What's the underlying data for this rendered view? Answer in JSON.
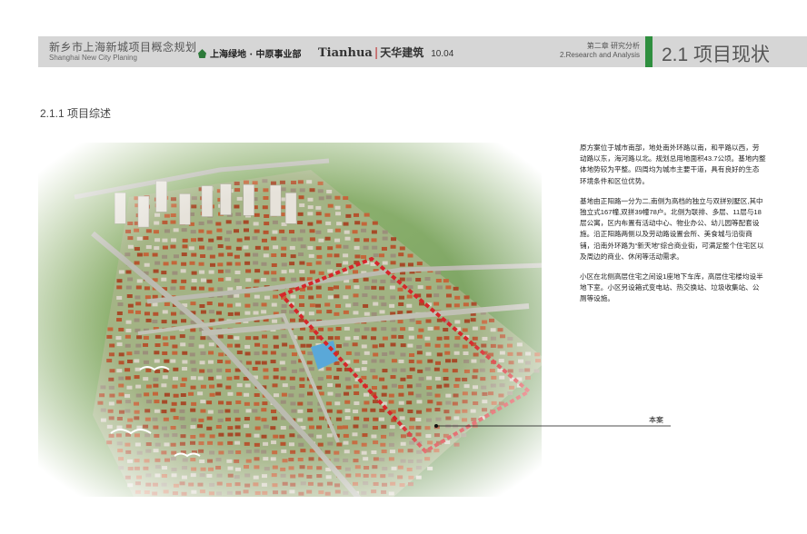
{
  "header": {
    "project_title": "新乡市上海新城项目概念规划",
    "project_title_en": "Shanghai New City Planing",
    "logo_greenland": "上海绿地 · 中原事业部",
    "logo_tianhua_en": "Tianhua",
    "logo_tianhua_cn": "天华建筑",
    "date": "10.04",
    "chapter_cn": "第二章  研究分析",
    "chapter_en": "2.Research and Analysis",
    "section_title": "2.1 项目现状"
  },
  "subsection": "2.1.1 项目综述",
  "description": [
    "原方案位于城市南部，地处南外环路以南，和平路以西，劳动路以东，海河路以北。规划总用地面积43.7公顷。基地内整体地势较为平整。四周均为城市主要干道，具有良好的生态环境条件和区位优势。",
    "基地由正阳路一分为二,南侧为高档的独立与双拼别墅区,其中独立式167幢,双拼39幢78户。北侧为联排、多层、11层与18层公寓，区内布置有活动中心、物业办公、幼儿园等配套设施。沿正阳路两侧以及劳动路设置会所、美食城与沿街商铺，沿南外环路为“新天地”综合商业街，可满足整个住宅区以及周边的商业、休闲等活动需求。",
    "小区在北侧高层住宅之间设1座地下车库，高层住宅楼均设半地下室。小区另设箱式变电站、热交换站、垃圾收集站、公厕等设施。"
  ],
  "callout_label": "本案",
  "colors": {
    "header_bg": "#d6d6d6",
    "accent_green": "#2f8f3f",
    "boundary_red": "#d6262a"
  }
}
